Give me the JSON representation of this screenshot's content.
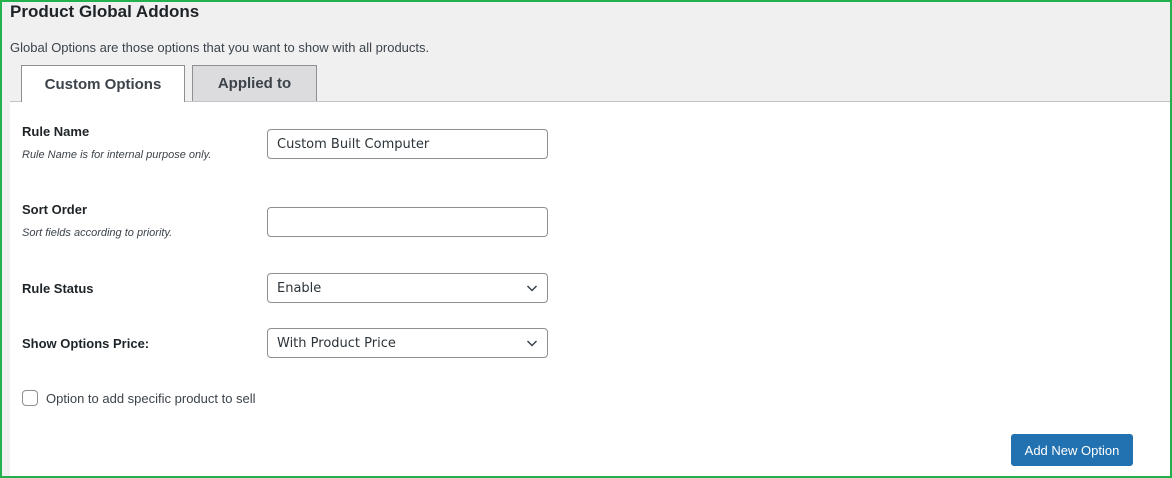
{
  "page": {
    "title": "Product Global Addons",
    "description": "Global Options are those options that you want to show with all products."
  },
  "tabs": [
    {
      "label": "Custom Options",
      "active": true
    },
    {
      "label": "Applied to",
      "active": false
    }
  ],
  "form": {
    "rule_name": {
      "label": "Rule Name",
      "help": "Rule Name is for internal purpose only.",
      "value": "Custom Built Computer"
    },
    "sort_order": {
      "label": "Sort Order",
      "help": "Sort fields according to priority.",
      "value": ""
    },
    "rule_status": {
      "label": "Rule Status",
      "selected": "Enable"
    },
    "show_options_price": {
      "label": "Show Options Price:",
      "selected": "With Product Price"
    },
    "specific_product": {
      "label": "Option to add specific product to sell",
      "checked": false
    },
    "add_button_label": "Add New Option"
  },
  "colors": {
    "accent": "#2271b1",
    "frame_border": "#22b14c",
    "background": "#f0f0f1"
  },
  "icons": {
    "select_caret": "chevron-down-icon"
  }
}
